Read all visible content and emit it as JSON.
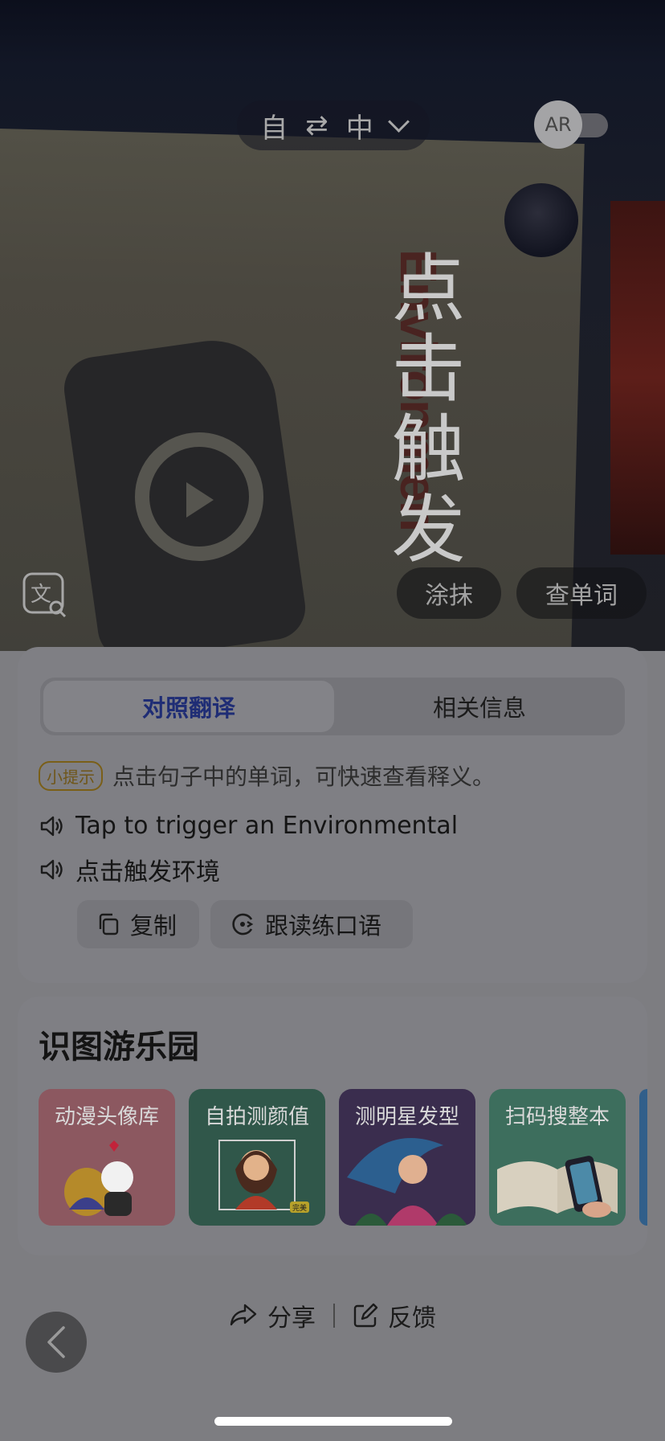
{
  "language": {
    "source": "自",
    "target": "中"
  },
  "ar_toggle": {
    "label": "AR",
    "on": false
  },
  "camera": {
    "overlay_text": "点击触发",
    "background_print": "Environmen"
  },
  "camera_buttons": {
    "smear": "涂抹",
    "lookup": "查单词"
  },
  "translation_card": {
    "tabs": {
      "active": "对照翻译",
      "other": "相关信息"
    },
    "tip_badge": "小提示",
    "tip_text": "点击句子中的单词，可快速查看释义。",
    "source_sentence": "Tap to trigger an Environmental",
    "translated_sentence": "点击触发环境",
    "copy_label": "复制",
    "follow_read_label": "跟读练口语"
  },
  "playground": {
    "title": "识图游乐园",
    "tiles": [
      {
        "label": "动漫头像库"
      },
      {
        "label": "自拍测颜值",
        "badge": "完美"
      },
      {
        "label": "测明星发型"
      },
      {
        "label": "扫码搜整本"
      }
    ]
  },
  "footer": {
    "share_label": "分享",
    "feedback_label": "反馈"
  },
  "colors": {
    "accent": "#1f2d75",
    "tip": "#6f5619"
  }
}
